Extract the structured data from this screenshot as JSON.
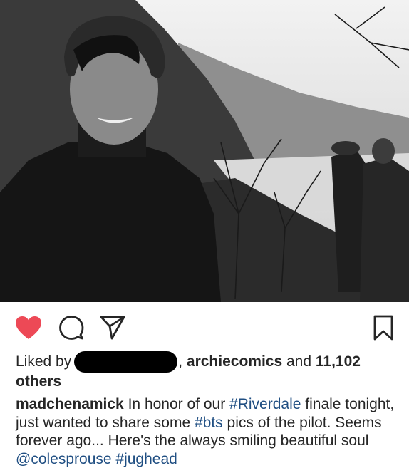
{
  "post": {
    "photo_alt": "black and white photo",
    "likes": {
      "prefix": "Liked by",
      "account": "archiecomics",
      "conjunction": "and",
      "count": "11,102",
      "suffix": "others"
    },
    "caption": {
      "username": "madchenamick",
      "t1": "In honor of our",
      "tag1": "#Riverdale",
      "t2": "finale tonight, just wanted to share some",
      "tag2": "#bts",
      "t3": "pics of the pilot. Seems forever ago... Here's the always smiling beautiful soul",
      "mention": "@colesprouse",
      "tag3": "#jughead"
    }
  },
  "icons": {
    "like": "heart-filled-icon",
    "comment": "comment-bubble-icon",
    "share": "paper-plane-icon",
    "save": "bookmark-icon"
  },
  "colors": {
    "heart": "#ED4956",
    "link": "#1F4E82",
    "text": "#262626"
  }
}
